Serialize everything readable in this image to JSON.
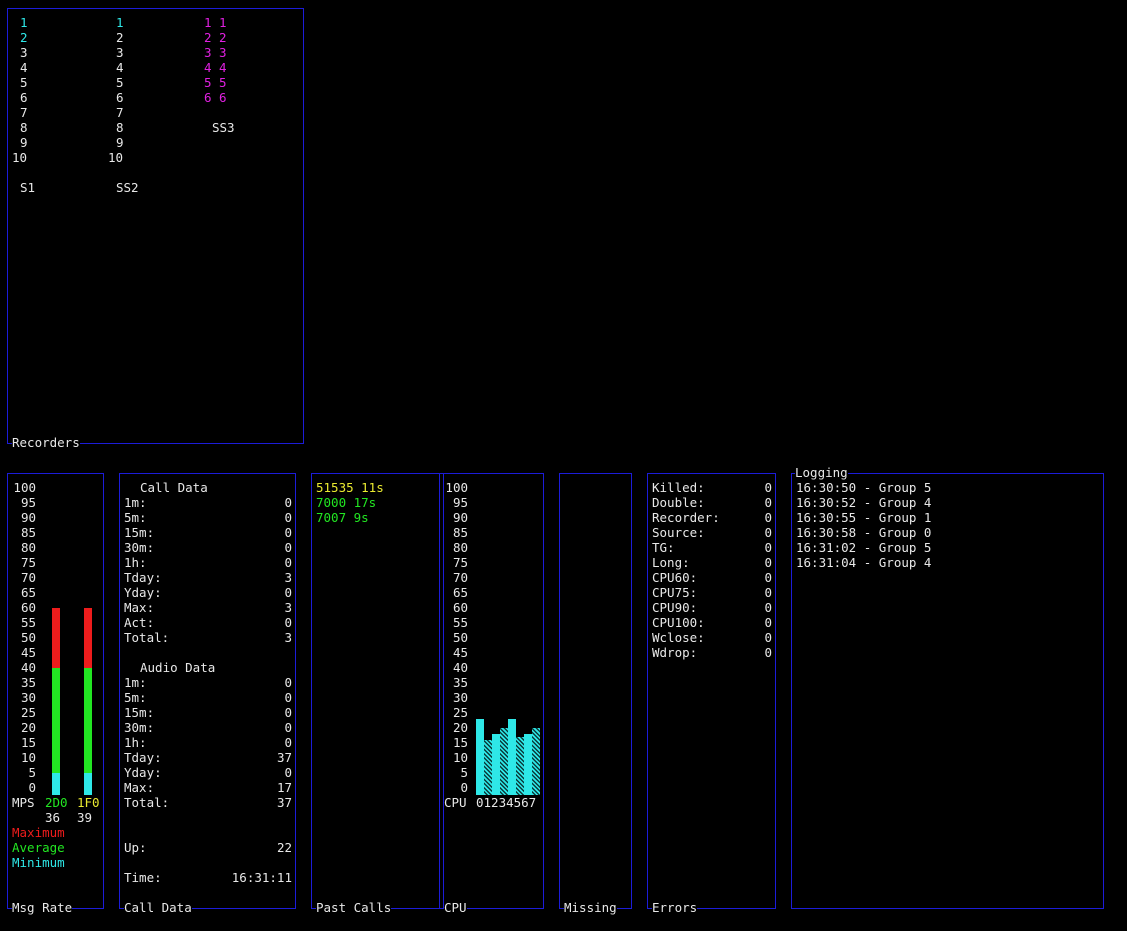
{
  "recorders": {
    "title": "Recorders",
    "groups": [
      {
        "name": "S1",
        "items": [
          "1",
          "2",
          "3",
          "4",
          "5",
          "6",
          "7",
          "8",
          "9",
          "10"
        ],
        "active_count": 2
      },
      {
        "name": "SS2",
        "items": [
          "1",
          "2",
          "3",
          "4",
          "5",
          "6",
          "7",
          "8",
          "9",
          "10"
        ],
        "active_count": 1
      },
      {
        "name": "SS3",
        "items": [
          "1 1",
          "2 2",
          "3 3",
          "4 4",
          "5 5",
          "6 6"
        ],
        "active_count": 6
      }
    ]
  },
  "msg_rate": {
    "title": "Msg Rate",
    "scale": [
      "100",
      "95",
      "90",
      "85",
      "80",
      "75",
      "70",
      "65",
      "60",
      "55",
      "50",
      "45",
      "40",
      "35",
      "30",
      "25",
      "20",
      "15",
      "10",
      "5",
      "0"
    ],
    "mps_label": "MPS",
    "sources": [
      {
        "label": "2D0",
        "value": "36",
        "max": 60,
        "avg": 40,
        "min": 5,
        "label_color": "#22e622"
      },
      {
        "label": "1F0",
        "value": "39",
        "max": 60,
        "avg": 40,
        "min": 5,
        "label_color": "#eaea30"
      }
    ],
    "legend": [
      {
        "label": "Maximum",
        "color": "#ee1c1c"
      },
      {
        "label": "Average",
        "color": "#22e622"
      },
      {
        "label": "Minimum",
        "color": "#2ee8e8"
      }
    ]
  },
  "call_data": {
    "title": "Call Data",
    "call_heading": "Call Data",
    "call_rows": [
      {
        "label": "1m:",
        "value": "0"
      },
      {
        "label": "5m:",
        "value": "0"
      },
      {
        "label": "15m:",
        "value": "0"
      },
      {
        "label": "30m:",
        "value": "0"
      },
      {
        "label": "1h:",
        "value": "0"
      },
      {
        "label": "Tday:",
        "value": "3"
      },
      {
        "label": "Yday:",
        "value": "0"
      },
      {
        "label": "Max:",
        "value": "3"
      },
      {
        "label": "Act:",
        "value": "0"
      },
      {
        "label": "Total:",
        "value": "3"
      }
    ],
    "audio_heading": "Audio Data",
    "audio_rows": [
      {
        "label": "1m:",
        "value": "0"
      },
      {
        "label": "5m:",
        "value": "0"
      },
      {
        "label": "15m:",
        "value": "0"
      },
      {
        "label": "30m:",
        "value": "0"
      },
      {
        "label": "1h:",
        "value": "0"
      },
      {
        "label": "Tday:",
        "value": "37"
      },
      {
        "label": "Yday:",
        "value": "0"
      },
      {
        "label": "Max:",
        "value": "17"
      },
      {
        "label": "Total:",
        "value": "37"
      }
    ],
    "up_label": "Up:",
    "up_value": "22",
    "time_label": "Time:",
    "time_value": "16:31:11"
  },
  "past_calls": {
    "title": "Past Calls",
    "items": [
      {
        "text": "51535 11s",
        "color": "#eaea30"
      },
      {
        "text": "7000 17s",
        "color": "#22e622"
      },
      {
        "text": "7007 9s",
        "color": "#22e622"
      }
    ]
  },
  "cpu": {
    "title": "CPU",
    "scale": [
      "100",
      "95",
      "90",
      "85",
      "80",
      "75",
      "70",
      "65",
      "60",
      "55",
      "50",
      "45",
      "40",
      "35",
      "30",
      "25",
      "20",
      "15",
      "10",
      "5",
      "0"
    ],
    "label": "CPU",
    "cores_label": "01234567",
    "cores": [
      {
        "value": 23,
        "style": "solid"
      },
      {
        "value": 16,
        "style": "hatch"
      },
      {
        "value": 18,
        "style": "solid"
      },
      {
        "value": 20,
        "style": "hatch"
      },
      {
        "value": 23,
        "style": "solid"
      },
      {
        "value": 17,
        "style": "hatch"
      },
      {
        "value": 18,
        "style": "solid"
      },
      {
        "value": 20,
        "style": "hatch"
      }
    ],
    "bar_color": "#2ee8e8"
  },
  "missing": {
    "title": "Missing"
  },
  "errors": {
    "title": "Errors",
    "rows": [
      {
        "label": "Killed:",
        "value": "0"
      },
      {
        "label": "Double:",
        "value": "0"
      },
      {
        "label": "Recorder:",
        "value": "0"
      },
      {
        "label": "Source:",
        "value": "0"
      },
      {
        "label": "TG:",
        "value": "0"
      },
      {
        "label": "Long:",
        "value": "0"
      },
      {
        "label": "CPU60:",
        "value": "0"
      },
      {
        "label": "CPU75:",
        "value": "0"
      },
      {
        "label": "CPU90:",
        "value": "0"
      },
      {
        "label": "CPU100:",
        "value": "0"
      },
      {
        "label": "Wclose:",
        "value": "0"
      },
      {
        "label": "Wdrop:",
        "value": "0"
      }
    ]
  },
  "logging": {
    "title": "Logging",
    "lines": [
      "16:30:50 - Group 5",
      "16:30:52 - Group 4",
      "16:30:55 - Group 1",
      "16:30:58 - Group 0",
      "16:31:02 - Group 5",
      "16:31:04 - Group 4"
    ]
  }
}
